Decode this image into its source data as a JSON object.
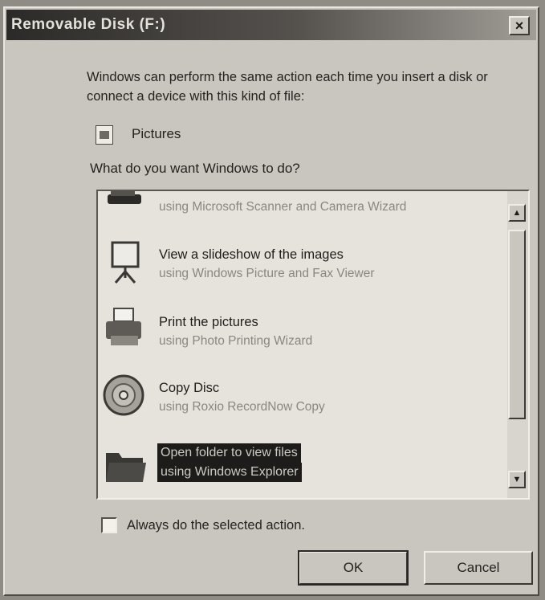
{
  "window": {
    "title": "Removable Disk (F:)",
    "close_glyph": "×"
  },
  "dialog": {
    "description": "Windows can perform the same action each time you insert a disk or connect a device with this kind of file:",
    "content_type_icon": "pictures-file-icon",
    "content_type": "Pictures",
    "question": "What do you want Windows to do?"
  },
  "actions": {
    "items": [
      {
        "title": "",
        "subtitle": "using Microsoft Scanner and Camera Wizard",
        "icon": "camera-wizard-icon"
      },
      {
        "title": "View a slideshow of the images",
        "subtitle": "using Windows Picture and Fax Viewer",
        "icon": "projector-screen-icon"
      },
      {
        "title": "Print the pictures",
        "subtitle": "using Photo Printing Wizard",
        "icon": "printer-icon"
      },
      {
        "title": "Copy Disc",
        "subtitle": "using Roxio RecordNow Copy",
        "icon": "cd-disc-icon"
      },
      {
        "title": "Open folder to view files",
        "subtitle": "using Windows Explorer",
        "icon": "folder-icon",
        "selected": true
      }
    ]
  },
  "scrollbar": {
    "up_glyph": "▲",
    "down_glyph": "▼"
  },
  "options": {
    "always_label": "Always do the selected action.",
    "always_checked": false
  },
  "buttons": {
    "ok": "OK",
    "cancel": "Cancel"
  },
  "colors": {
    "selection": "#1d1c1a",
    "window_bg": "#c9c6bf"
  }
}
